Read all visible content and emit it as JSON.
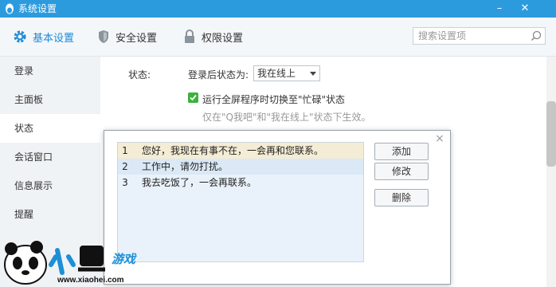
{
  "window": {
    "title": "系统设置",
    "minimize": "–",
    "close": "✕"
  },
  "toolbar": {
    "tabs": [
      {
        "label": "基本设置",
        "icon": "gear-icon",
        "active": true
      },
      {
        "label": "安全设置",
        "icon": "shield-icon",
        "active": false
      },
      {
        "label": "权限设置",
        "icon": "lock-icon",
        "active": false
      }
    ],
    "search": {
      "placeholder": "搜索设置项",
      "icon": "search-icon"
    }
  },
  "sidebar": {
    "items": [
      {
        "label": "登录"
      },
      {
        "label": "主面板"
      },
      {
        "label": "状态",
        "active": true
      },
      {
        "label": "会话窗口"
      },
      {
        "label": "信息展示"
      },
      {
        "label": "提醒"
      }
    ]
  },
  "status_section": {
    "label": "状态:",
    "after_login_label": "登录后状态为:",
    "after_login_value": "我在线上",
    "checkbox_label": "运行全屏程序时切换至\"忙碌\"状态",
    "checkbox_checked": true,
    "hint": "仅在\"Q我吧\"和\"我在线上\"状态下生效。"
  },
  "auto_reply_dialog": {
    "rows": [
      {
        "num": "1",
        "text": "您好，我现在有事不在，一会再和您联系。",
        "selected": true
      },
      {
        "num": "2",
        "text": "工作中，请勿打扰。",
        "selected": false
      },
      {
        "num": "3",
        "text": "我去吃饭了，一会再联系。",
        "selected": false
      }
    ],
    "buttons": {
      "add": "添加",
      "edit": "修改",
      "delete": "删除"
    },
    "close": "×"
  },
  "watermark": {
    "brand": "小黑游戏",
    "url": "www.xiaohei.com"
  },
  "colors": {
    "titlebar": "#2c9bde",
    "accent": "#1e8ad6",
    "check": "#3bb33b",
    "selected_row": "#f4ecd4"
  }
}
